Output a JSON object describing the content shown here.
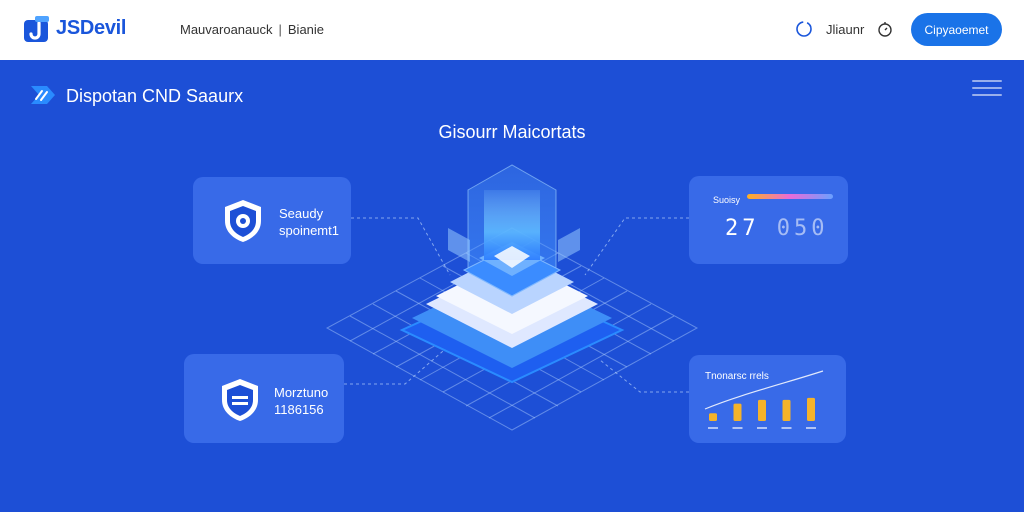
{
  "header": {
    "brand": "JSDevil",
    "nav": [
      "Mauvaroanauck",
      "Bianie"
    ],
    "nav_separator": "|",
    "language": "Jliaunr",
    "cta_label": "Cipyaoemet"
  },
  "hero": {
    "title": "Dispotan CND Saaurx",
    "section_title": "Gisourr Maicortats"
  },
  "cards": {
    "security": {
      "line1": "Seaudy",
      "line2": "spoinemt1"
    },
    "counter": {
      "label": "Suoisy",
      "value_bright": "27",
      "value_dim": "050"
    },
    "monitor": {
      "line1": "Morztuno",
      "line2": "1186156"
    },
    "chart": {
      "title": "Tnonarsc rrels"
    }
  },
  "chart_data": {
    "type": "bar",
    "values": [
      0.2,
      0.45,
      0.55,
      0.55,
      0.6
    ],
    "trend_line": true
  },
  "colors": {
    "background": "#1d4fd6",
    "brand_blue": "#1a56db",
    "cta": "#1a73e8",
    "bar": "#f5b32a"
  },
  "icons": [
    "logo-icon",
    "globe-icon",
    "bell-icon",
    "shield-icon",
    "menu-icon"
  ]
}
